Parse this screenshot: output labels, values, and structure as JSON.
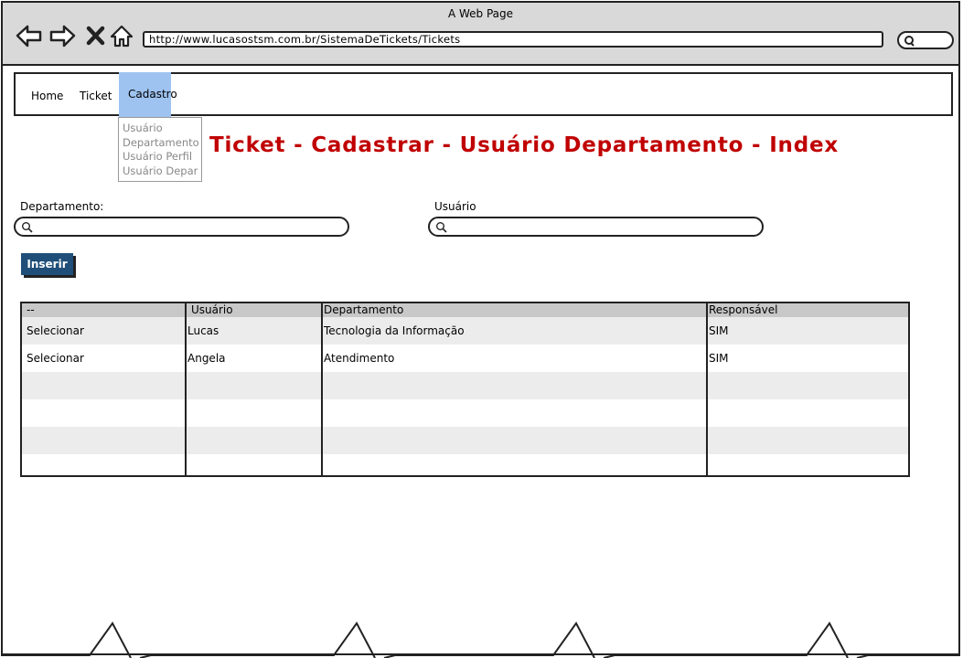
{
  "window": {
    "title": "A Web Page",
    "url": "http://www.lucasostsm.com.br/SistemaDeTickets/Tickets"
  },
  "menu": {
    "items": [
      {
        "label": "Home"
      },
      {
        "label": "Ticket"
      },
      {
        "label": "Cadastro",
        "active": true
      }
    ],
    "dropdown": [
      "Usuário",
      "Departamento",
      "Usuário Perfil",
      "Usuário Depar"
    ]
  },
  "page": {
    "title": "Ticket - Cadastrar - Usuário Departamento - Index"
  },
  "form": {
    "departamento_label": "Departamento:",
    "usuario_label": "Usuário",
    "insert_label": "Inserir"
  },
  "table": {
    "headers": [
      "--",
      "Usuário",
      "Departamento",
      "Responsável"
    ],
    "rows": [
      [
        "Selecionar",
        "Lucas",
        "Tecnologia da Informação",
        "SIM"
      ],
      [
        "Selecionar",
        "Angela",
        "Atendimento",
        "SIM"
      ]
    ]
  },
  "colors": {
    "accent_menu": "#9ec3f0",
    "title_red": "#c00000",
    "button_blue": "#1f4e79"
  }
}
